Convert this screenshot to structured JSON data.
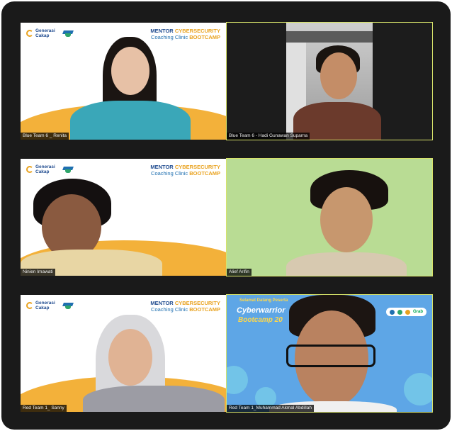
{
  "branding": {
    "logo_line1": "Generasi",
    "logo_line2": "Cakap",
    "headline_mentor": "MENTOR",
    "headline_cyber": "CYBERSECURITY",
    "headline_clinic": "Coaching Clinic",
    "headline_bootcamp": "BOOTCAMP"
  },
  "tiles": [
    {
      "name": "Blue Team 6 _ Renita",
      "active": false
    },
    {
      "name": "Blue Team 6 - Hadi Gunawan Suparna",
      "active": true
    },
    {
      "name": "Ninien Imawati",
      "active": false
    },
    {
      "name": "Alief Arifin",
      "active": true
    },
    {
      "name": "Red Team 1_ Sanny",
      "active": false
    },
    {
      "name": "Red Team 1_Muhammad Akmal Abdillah",
      "active": true
    }
  ],
  "banner": {
    "welcome": "Selamat Datang Peserta",
    "title1": "Cyberwarrior",
    "title2": "Bootcamp 20",
    "sponsor": "Grab"
  },
  "colors": {
    "active_border": "#d7e36a",
    "brand_orange": "#f3b13a",
    "brand_blue": "#1f4b8f"
  }
}
